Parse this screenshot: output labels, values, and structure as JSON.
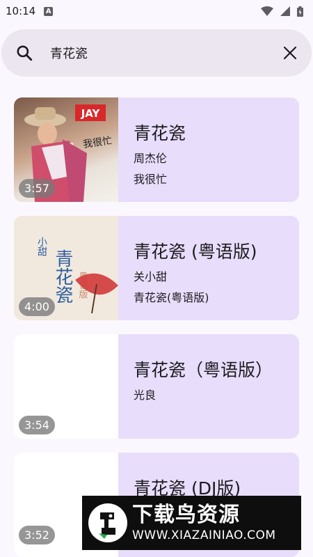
{
  "status": {
    "time": "10:14",
    "notif_icon": "A"
  },
  "search": {
    "query": "青花瓷"
  },
  "results": [
    {
      "title": "青花瓷",
      "artist": "周杰伦",
      "album": "我很忙",
      "duration": "3:57"
    },
    {
      "title": "青花瓷 (粤语版)",
      "artist": "关小甜",
      "album": "青花瓷(粤语版)",
      "duration": "4:00"
    },
    {
      "title": "青花瓷（粤语版）",
      "artist": "光良",
      "album": "",
      "duration": "3:54"
    },
    {
      "title": "青花瓷 (DJ版)",
      "artist": "",
      "album": "",
      "duration": "3:52"
    }
  ],
  "thumb1": {
    "badge": "JAY",
    "script": "我很忙"
  },
  "thumb2": {
    "text": "青花瓷",
    "artist": "小甜",
    "sub": "粤语版"
  },
  "watermark": {
    "title": "下载鸟资源",
    "url": "WWW.XIAZAINIAO.COM"
  },
  "colors": {
    "card": "#e8ddfb",
    "background": "#fbf7fe",
    "search": "#ece6f0"
  }
}
